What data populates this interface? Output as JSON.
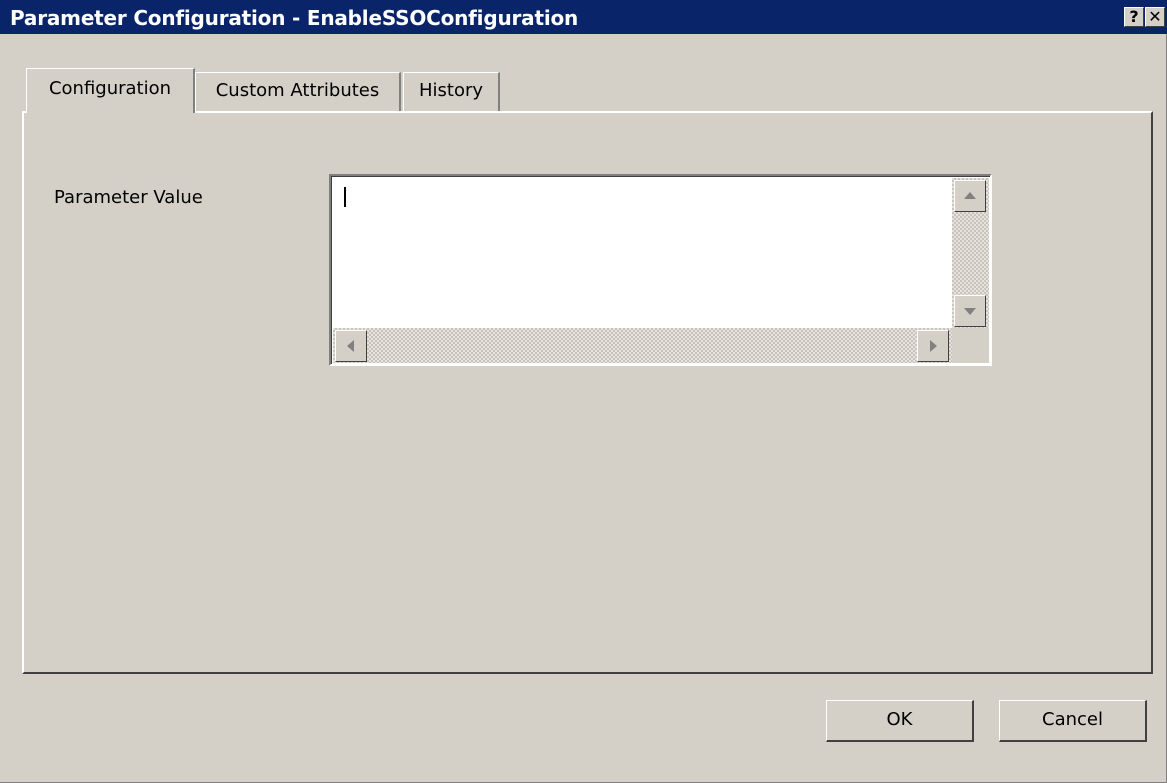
{
  "window": {
    "title": "Parameter Configuration - EnableSSOConfiguration",
    "help_label": "?",
    "close_label": "✕"
  },
  "tabs": [
    {
      "label": "Configuration",
      "active": true
    },
    {
      "label": "Custom Attributes",
      "active": false
    },
    {
      "label": "History",
      "active": false
    }
  ],
  "form": {
    "parameter_label": "Parameter Value",
    "parameter_value": ""
  },
  "buttons": {
    "ok_label": "OK",
    "cancel_label": "Cancel"
  },
  "colors": {
    "titlebar": "#0a246a",
    "face": "#d4d0c8"
  },
  "icons": {
    "help": "help-icon",
    "close": "close-icon",
    "scroll_up": "arrow-up-icon",
    "scroll_down": "arrow-down-icon",
    "scroll_left": "arrow-left-icon",
    "scroll_right": "arrow-right-icon"
  }
}
